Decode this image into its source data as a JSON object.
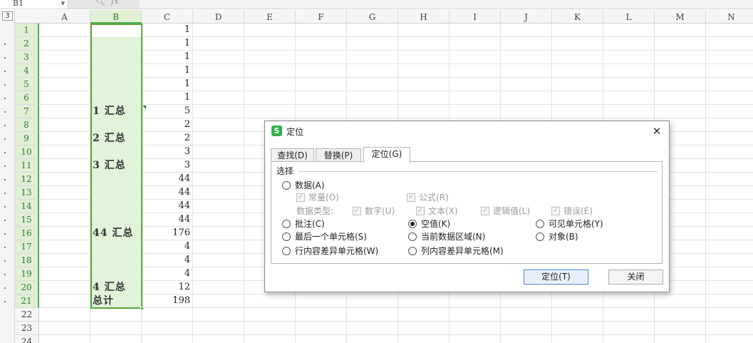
{
  "formula_bar": {
    "name_box": "B1",
    "search_icon": "magnifier-icon",
    "fx_label": "fx"
  },
  "outline": {
    "level_button": "3"
  },
  "columns": [
    "A",
    "B",
    "C",
    "D",
    "E",
    "F",
    "G",
    "H",
    "I",
    "J",
    "K",
    "L",
    "M",
    "N"
  ],
  "rows": [
    {
      "num": "1",
      "b": "",
      "c": "1"
    },
    {
      "num": "2",
      "b": "",
      "c": "1"
    },
    {
      "num": "3",
      "b": "",
      "c": "1"
    },
    {
      "num": "4",
      "b": "",
      "c": "1"
    },
    {
      "num": "5",
      "b": "",
      "c": "1"
    },
    {
      "num": "6",
      "b": "",
      "c": "1"
    },
    {
      "num": "7",
      "b": "1 汇总",
      "c": "5"
    },
    {
      "num": "8",
      "b": "",
      "c": "2"
    },
    {
      "num": "9",
      "b": "2 汇总",
      "c": "2"
    },
    {
      "num": "10",
      "b": "",
      "c": "3"
    },
    {
      "num": "11",
      "b": "3 汇总",
      "c": "3"
    },
    {
      "num": "12",
      "b": "",
      "c": "44"
    },
    {
      "num": "13",
      "b": "",
      "c": "44"
    },
    {
      "num": "14",
      "b": "",
      "c": "44"
    },
    {
      "num": "15",
      "b": "",
      "c": "44"
    },
    {
      "num": "16",
      "b": "44 汇总",
      "c": "176"
    },
    {
      "num": "17",
      "b": "",
      "c": "4"
    },
    {
      "num": "18",
      "b": "",
      "c": "4"
    },
    {
      "num": "19",
      "b": "",
      "c": "4"
    },
    {
      "num": "20",
      "b": "4 汇总",
      "c": "12"
    },
    {
      "num": "21",
      "b": "总计",
      "c": "198"
    },
    {
      "num": "22",
      "b": "",
      "c": ""
    },
    {
      "num": "23",
      "b": "",
      "c": ""
    },
    {
      "num": "24",
      "b": "",
      "c": ""
    }
  ],
  "dialog": {
    "title": "定位",
    "logo_letter": "S",
    "close": "✕",
    "tabs": [
      "查找(D)",
      "替换(P)",
      "定位(G)"
    ],
    "group_label": "选择",
    "options": {
      "data": "数据(A)",
      "constant": "常量(O)",
      "formula": "公式(R)",
      "data_type_label": "数据类型:",
      "number": "数字(U)",
      "text": "文本(X)",
      "logical": "逻辑值(L)",
      "error": "错误(E)",
      "comments": "批注(C)",
      "blank": "空值(K)",
      "visible": "可见单元格(Y)",
      "last_cell": "最后一个单元格(S)",
      "current_region": "当前数据区域(N)",
      "objects": "对象(B)",
      "row_diff": "行内容差异单元格(W)",
      "col_diff": "列内容差异单元格(M)"
    },
    "selected_option": "blank",
    "buttons": {
      "goto": "定位(T)",
      "close": "关闭"
    }
  },
  "colors": {
    "selection_green": "#5aa43a",
    "selection_fill": "#e1f3d8",
    "logo_green": "#2eb24a"
  }
}
